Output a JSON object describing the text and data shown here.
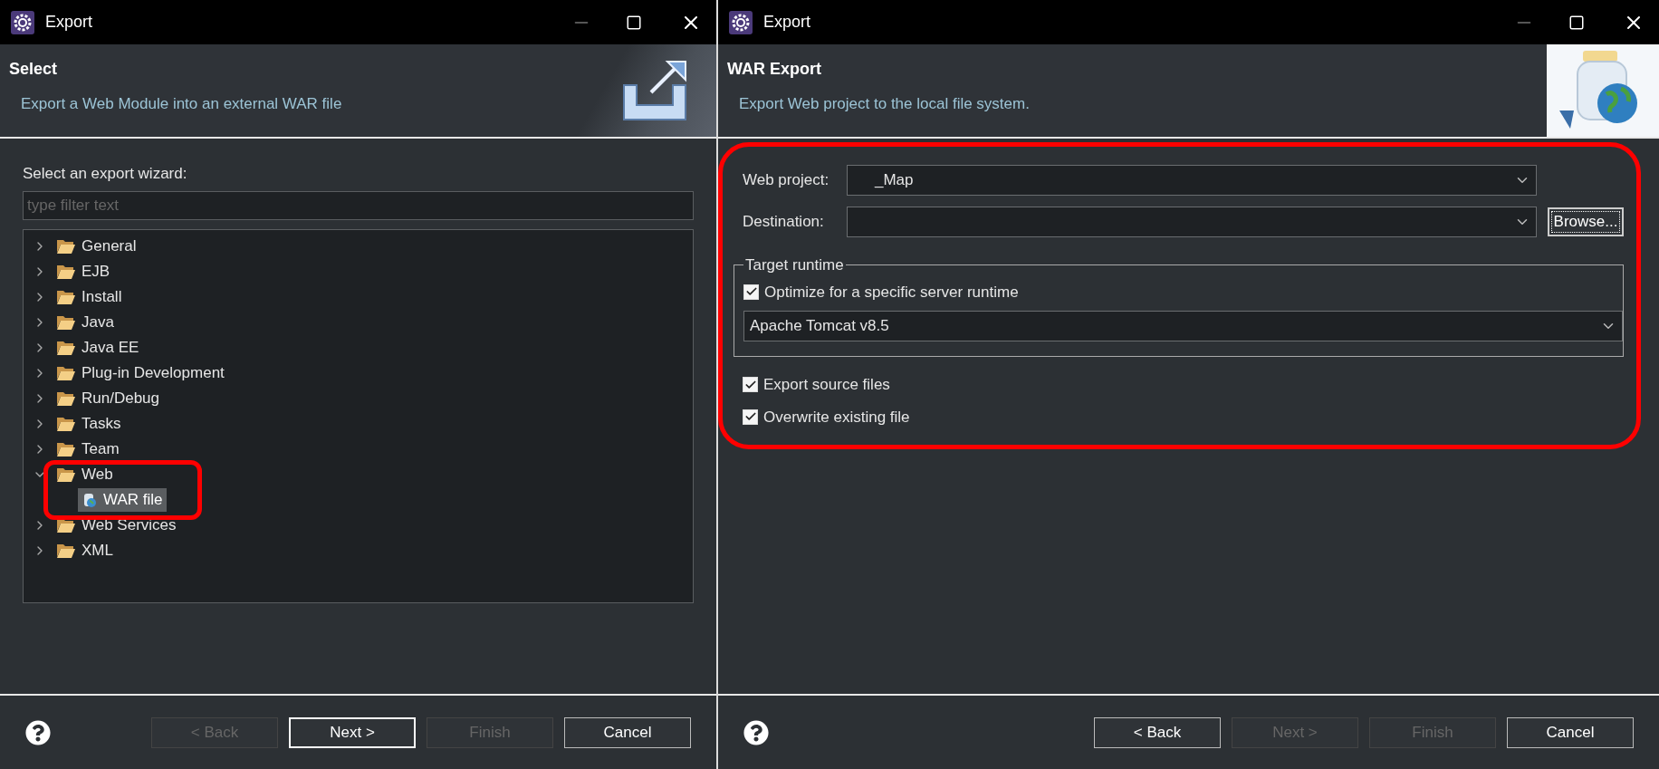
{
  "left_dialog": {
    "window": {
      "title": "Export"
    },
    "header": {
      "title": "Select",
      "description": "Export a Web Module into an external WAR file"
    },
    "wizard_label": "Select an export wizard:",
    "filter": {
      "placeholder": "type filter text"
    },
    "tree": [
      {
        "label": "General",
        "expanded": false,
        "highlighted": false
      },
      {
        "label": "EJB",
        "expanded": false,
        "highlighted": false
      },
      {
        "label": "Install",
        "expanded": false,
        "highlighted": false
      },
      {
        "label": "Java",
        "expanded": false,
        "highlighted": false
      },
      {
        "label": "Java EE",
        "expanded": false,
        "highlighted": false
      },
      {
        "label": "Plug-in Development",
        "expanded": false,
        "highlighted": false
      },
      {
        "label": "Run/Debug",
        "expanded": false,
        "highlighted": false
      },
      {
        "label": "Tasks",
        "expanded": false,
        "highlighted": false
      },
      {
        "label": "Team",
        "expanded": false,
        "highlighted": false
      },
      {
        "label": "Web",
        "expanded": true,
        "highlighted": true,
        "children": [
          {
            "label": "WAR file",
            "selected": true
          }
        ]
      },
      {
        "label": "Web Services",
        "expanded": false,
        "highlighted": false
      },
      {
        "label": "XML",
        "expanded": false,
        "highlighted": false
      }
    ],
    "buttons": [
      {
        "label": "< Back",
        "disabled": true,
        "default": false
      },
      {
        "label": "Next >",
        "disabled": false,
        "default": true
      },
      {
        "label": "Finish",
        "disabled": true,
        "default": false
      },
      {
        "label": "Cancel",
        "disabled": false,
        "default": false
      }
    ]
  },
  "right_dialog": {
    "window": {
      "title": "Export"
    },
    "header": {
      "title": "WAR Export",
      "description": "Export Web project to the local file system."
    },
    "form_highlighted": true,
    "web_project": {
      "label": "Web project:",
      "value": "_Map"
    },
    "destination": {
      "label": "Destination:"
    },
    "browse_button": "Browse...",
    "target_runtime": {
      "title": "Target runtime",
      "optimize": {
        "label": "Optimize for a specific server runtime",
        "checked": true
      },
      "runtime": "Apache Tomcat v8.5"
    },
    "options": [
      {
        "label": "Export source files",
        "checked": true
      },
      {
        "label": "Overwrite existing file",
        "checked": true
      }
    ],
    "buttons": [
      {
        "label": "< Back",
        "disabled": false,
        "default": false
      },
      {
        "label": "Next >",
        "disabled": true,
        "default": false
      },
      {
        "label": "Finish",
        "disabled": true,
        "default": false
      },
      {
        "label": "Cancel",
        "disabled": false,
        "default": false
      }
    ]
  }
}
